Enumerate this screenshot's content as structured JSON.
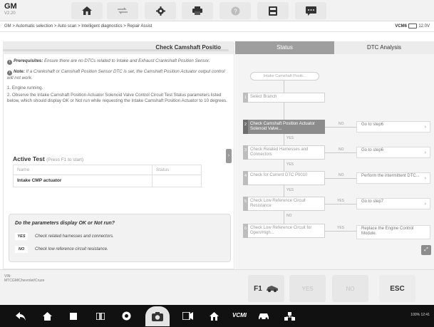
{
  "header": {
    "make": "GM",
    "version": "V2.20",
    "icons": [
      "home-icon",
      "vehicle-swap-icon",
      "settings-icon",
      "print-icon",
      "help-icon",
      "save-icon",
      "message-icon"
    ]
  },
  "breadcrumb": {
    "path": "GM > Automatic selection > Auto scan > Intelligent diagnostics > Repair Assist",
    "vcm": "VCM6",
    "battery": "12.0V"
  },
  "left_panel": {
    "title": "Check Camshaft Positio",
    "prereq_label": "Prerequisites:",
    "prereq_text": "Ensure there are no DTCs related to Intake and Exhaust Crankshaft Position Sensor.",
    "note_label": "Note:",
    "note_text": "If a Crankshaft or Camshaft Position Sensor DTC is set, the Camshaft Position Actuator output control will not work.",
    "step1": "1. Engine running.",
    "step2": "2. Observe the Intake Camshaft Position Actuator Solenoid Valve Control Circuit Test Status parameters listed below, which should display OK or Not run while requesting the Intake Camshaft Position Actuator to 10 degrees.",
    "active_test_title": "Active Test",
    "active_test_hint": "(Press F1 to start)",
    "table_headers": [
      "Name",
      "Status"
    ],
    "table_rows": [
      {
        "name": "Intake CMP actuator",
        "status": ""
      }
    ],
    "question": "Do the parameters display OK or Not run?",
    "answer_yes_key": "YES",
    "answer_yes_text": "Check related harnesses and connectors.",
    "answer_no_key": "NO",
    "answer_no_text": "Check low reference circuit resistance."
  },
  "right_panel": {
    "tab_status": "Status",
    "tab_dtc": "DTC Analysis",
    "start_node": "Intake Camshaft Positi...",
    "nodes": [
      {
        "num": "1",
        "text": "Select Branch"
      },
      {
        "num": "2",
        "text": "Check Camshaft Position Actuator Solenoid Valve..."
      },
      {
        "num": "3",
        "text": "Check Related Harnesses and Connectors"
      },
      {
        "num": "4",
        "text": "Check for Current DTC P0010"
      },
      {
        "num": "5",
        "text": "Check Low Reference Circuit Resistance"
      },
      {
        "num": "6",
        "text": "Check Low Reference Circuit for Open/High..."
      }
    ],
    "branches": [
      {
        "label": "NO",
        "text": "Go to step6"
      },
      {
        "label": "NO",
        "text": "Go to step6"
      },
      {
        "label": "NO",
        "text": "Perform the intermittent DTC..."
      },
      {
        "label": "YES",
        "text": "Go to step7"
      },
      {
        "label": "YES",
        "text": "Replace the Engine Control Module."
      }
    ],
    "connector_labels": [
      "YES",
      "YES",
      "YES",
      "NO"
    ]
  },
  "function_bar": {
    "vin_label": "VIN:",
    "vin_path": "MTCGM/Chevrolet/Cruze",
    "f1": "F1",
    "yes": "YES",
    "no": "NO",
    "esc": "ESC"
  },
  "navbar": {
    "vcm_label": "VCMI",
    "status": "100% 12:41"
  }
}
